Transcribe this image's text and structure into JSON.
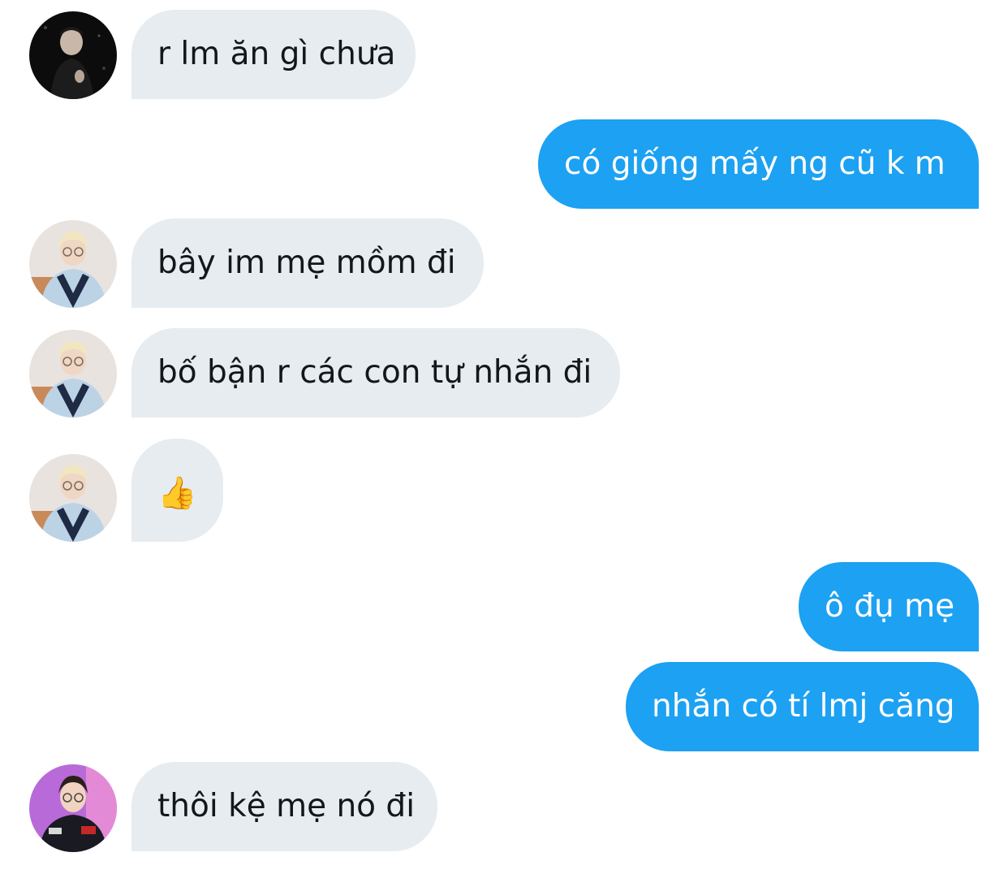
{
  "conversation": {
    "messages": [
      {
        "direction": "incoming",
        "avatar": "dark-user-avatar",
        "text": "r lm ăn gì chưa"
      },
      {
        "direction": "outgoing",
        "text": "có giống mấy ng cũ k m"
      },
      {
        "direction": "incoming",
        "avatar": "blonde-user-avatar",
        "text": "bây im mẹ mồm đi"
      },
      {
        "direction": "incoming",
        "avatar": "blonde-user-avatar",
        "text": "bố bận r các con tự nhắn đi"
      },
      {
        "direction": "incoming",
        "avatar": "blonde-user-avatar",
        "text": "👍"
      },
      {
        "direction": "outgoing",
        "text": "ô đụ mẹ"
      },
      {
        "direction": "outgoing",
        "text": "nhắn có tí lmj căng"
      },
      {
        "direction": "incoming",
        "avatar": "jersey-user-avatar",
        "text": "thôi kệ mẹ nó đi"
      }
    ]
  },
  "colors": {
    "incoming_bubble": "#e6ecf0",
    "outgoing_bubble": "#1da1f2",
    "incoming_text": "#14171a",
    "outgoing_text": "#ffffff"
  }
}
